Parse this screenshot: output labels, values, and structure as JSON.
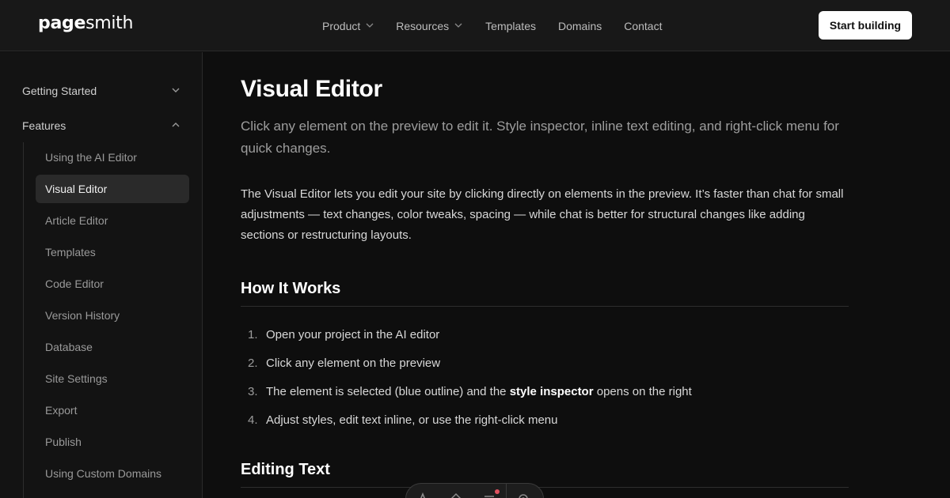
{
  "brand": {
    "logo_bold": "page",
    "logo_light": "smith"
  },
  "nav": {
    "items": [
      {
        "label": "Product",
        "has_dropdown": true
      },
      {
        "label": "Resources",
        "has_dropdown": true
      },
      {
        "label": "Templates",
        "has_dropdown": false
      },
      {
        "label": "Domains",
        "has_dropdown": false
      },
      {
        "label": "Contact",
        "has_dropdown": false
      }
    ],
    "cta_label": "Start building"
  },
  "sidebar": {
    "sections": [
      {
        "label": "Getting Started",
        "expanded": false
      },
      {
        "label": "Features",
        "expanded": true
      }
    ],
    "items": [
      {
        "label": "Using the AI Editor",
        "active": false
      },
      {
        "label": "Visual Editor",
        "active": true
      },
      {
        "label": "Article Editor",
        "active": false
      },
      {
        "label": "Templates",
        "active": false
      },
      {
        "label": "Code Editor",
        "active": false
      },
      {
        "label": "Version History",
        "active": false
      },
      {
        "label": "Database",
        "active": false
      },
      {
        "label": "Site Settings",
        "active": false
      },
      {
        "label": "Export",
        "active": false
      },
      {
        "label": "Publish",
        "active": false
      },
      {
        "label": "Using Custom Domains",
        "active": false
      }
    ]
  },
  "article": {
    "title": "Visual Editor",
    "lede": "Click any element on the preview to edit it. Style inspector, inline text editing, and right-click menu for quick changes.",
    "intro": "The Visual Editor lets you edit your site by clicking directly on elements in the preview. It’s faster than chat for small adjustments — text changes, color tweaks, spacing — while chat is better for structural changes like adding sections or restructuring layouts.",
    "how_it_works": {
      "heading": "How It Works",
      "steps": [
        {
          "num": "1.",
          "text": "Open your project in the AI editor"
        },
        {
          "num": "2.",
          "text": "Click any element on the preview"
        },
        {
          "num": "3.",
          "text_before": "The element is selected (blue outline) and the ",
          "bold": "style inspector",
          "text_after": " opens on the right"
        },
        {
          "num": "4.",
          "text": "Adjust styles, edit text inline, or use the right-click menu"
        }
      ]
    },
    "editing_text": {
      "heading": "Editing Text"
    }
  },
  "toolbar": {
    "icons": [
      "text-icon",
      "paint-icon",
      "layers-icon",
      "settings-icon"
    ]
  },
  "colors": {
    "background": "#0e0e0e",
    "header": "#181818",
    "sidebar": "#131313",
    "active_item": "#2a2a2a",
    "cta_bg": "#ffffff",
    "notification_dot": "#e05260"
  }
}
